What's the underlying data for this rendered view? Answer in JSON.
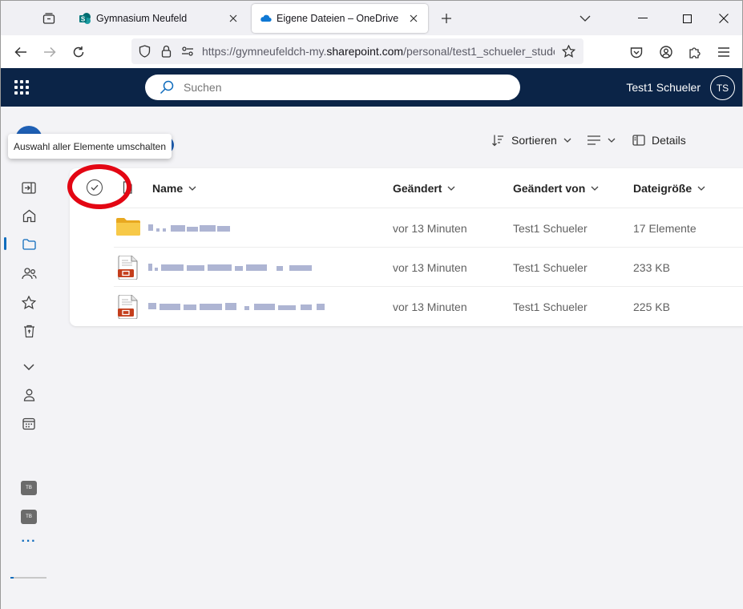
{
  "browser": {
    "tabs": [
      {
        "label": "Gymnasium Neufeld",
        "icon": "sharepoint-icon"
      },
      {
        "label": "Eigene Dateien – OneDrive",
        "icon": "onedrive-icon",
        "active": true
      }
    ],
    "url_prefix": "https://gymneufeldch-my.",
    "url_domain": "sharepoint.com",
    "url_suffix": "/personal/test1_schueler_stude"
  },
  "header": {
    "search_placeholder": "Suchen",
    "user_name": "Test1 Schueler",
    "user_initials": "TS"
  },
  "rail": {
    "badge1": "TB",
    "badge2": "TB",
    "more": "···"
  },
  "tooltip": "Auswahl aller Elemente umschalten",
  "commands": {
    "sort_label": "Sortieren",
    "details_label": "Details"
  },
  "columns": {
    "name": "Name",
    "modified": "Geändert",
    "modified_by": "Geändert von",
    "size": "Dateigröße"
  },
  "rows": [
    {
      "type": "folder",
      "modified": "vor 13 Minuten",
      "modified_by": "Test1 Schueler",
      "size": "17 Elemente"
    },
    {
      "type": "pdf",
      "modified": "vor 13 Minuten",
      "modified_by": "Test1 Schueler",
      "size": "233 KB"
    },
    {
      "type": "pdf",
      "modified": "vor 13 Minuten",
      "modified_by": "Test1 Schueler",
      "size": "225 KB"
    }
  ],
  "colors": {
    "header_bg": "#0b2447",
    "accent": "#0f6cbd",
    "highlight_ring": "#e30613",
    "folder": "#f4c030",
    "pdf": "#c43e1c"
  }
}
